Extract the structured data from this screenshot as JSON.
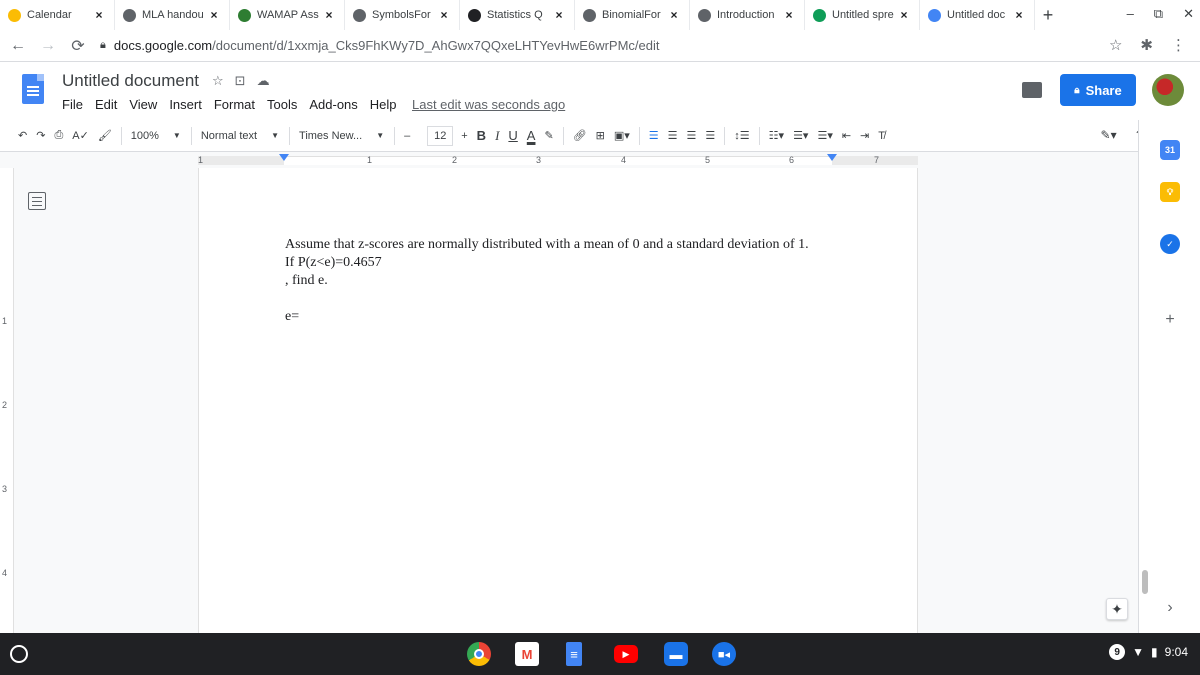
{
  "browser": {
    "tabs": [
      {
        "title": "Calendar",
        "icon": "calendar-icon",
        "color": "#fbbc04",
        "active": false
      },
      {
        "title": "MLA handou",
        "icon": "globe-icon",
        "color": "#5f6368",
        "active": false
      },
      {
        "title": "WAMAP Ass",
        "icon": "wamap-icon",
        "color": "#2e7d32",
        "active": false
      },
      {
        "title": "SymbolsFor",
        "icon": "globe-icon",
        "color": "#5f6368",
        "active": false
      },
      {
        "title": "Statistics Q",
        "icon": "bartleby-icon",
        "color": "#202124",
        "active": false
      },
      {
        "title": "BinomialFor",
        "icon": "globe-icon",
        "color": "#5f6368",
        "active": false
      },
      {
        "title": "Introduction",
        "icon": "globe-icon",
        "color": "#5f6368",
        "active": false
      },
      {
        "title": "Untitled spre",
        "icon": "sheets-icon",
        "color": "#0f9d58",
        "active": false
      },
      {
        "title": "Untitled doc",
        "icon": "docs-icon",
        "color": "#4285f4",
        "active": true
      }
    ],
    "new_tab": "+",
    "window_controls": {
      "minimize": "–",
      "restore": "⧉",
      "close": "✕"
    },
    "url_host": "docs.google.com",
    "url_path": "/document/d/1xxmja_Cks9FhKWy7D_AhGwx7QQxeLHTYevHwE6wrPMc/edit"
  },
  "docs": {
    "title": "Untitled document",
    "menu": [
      "File",
      "Edit",
      "View",
      "Insert",
      "Format",
      "Tools",
      "Add-ons",
      "Help"
    ],
    "last_edit": "Last edit was seconds ago",
    "share_label": "Share"
  },
  "toolbar": {
    "zoom": "100%",
    "style": "Normal text",
    "font": "Times New...",
    "font_size": "12",
    "minus": "–",
    "plus": "+",
    "bold": "B",
    "italic": "I",
    "underline": "U",
    "text_color": "A"
  },
  "ruler": {
    "numbers": [
      "1",
      "1",
      "2",
      "3",
      "4",
      "5",
      "6",
      "7"
    ]
  },
  "vruler": {
    "numbers": [
      "1",
      "2",
      "3",
      "4"
    ]
  },
  "document": {
    "line1": "Assume that z-scores are normally distributed with a mean of 0 and a standard deviation of 1.",
    "line2": "If P(z<e)=0.4657",
    "line3": ", find e.",
    "answer": "e="
  },
  "sidepanel": {
    "calendar_day": "31",
    "add": "+",
    "expand": "›"
  },
  "shelf": {
    "notification_count": "9",
    "time": "9:04"
  }
}
